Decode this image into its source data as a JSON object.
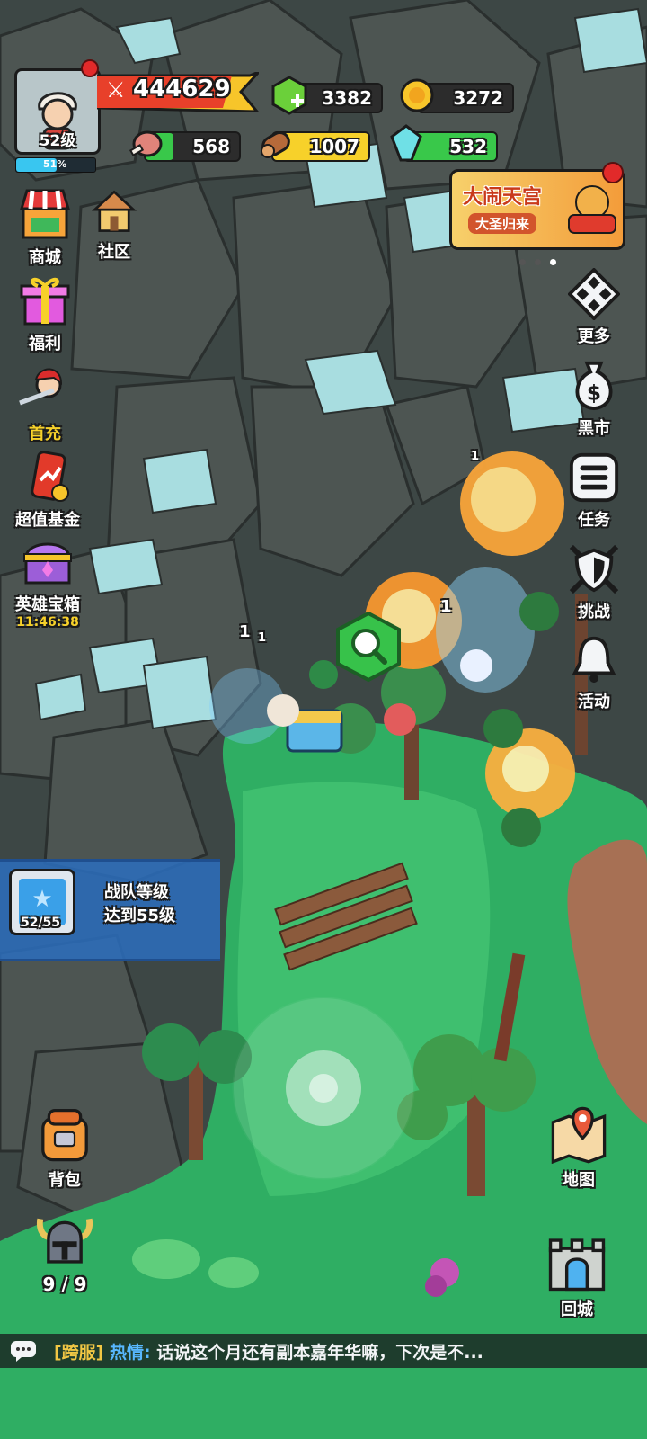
{
  "player": {
    "level_label": "52级",
    "xp_percent_label": "51%",
    "xp_fraction": 0.51,
    "power": "444629",
    "notification": true
  },
  "resources": {
    "gems": "3382",
    "gold": "3272",
    "meat": "568",
    "wood": "1007",
    "crystal": "532"
  },
  "event_banner": {
    "title": "大闹天宫",
    "subtitle": "大圣归来"
  },
  "left_menu": {
    "shop": "商城",
    "community": "社区",
    "welfare": "福利",
    "first_charge": "首充",
    "fund": "超值基金",
    "hero_chest": "英雄宝箱",
    "hero_chest_timer": "11:46:38"
  },
  "right_menu": {
    "more": "更多",
    "black_market": "黑市",
    "tasks": "任务",
    "challenge": "挑战",
    "events": "活动"
  },
  "quest": {
    "progress": "52/55",
    "line1": "战队等级",
    "line2": "达到55级"
  },
  "bottom": {
    "backpack": "背包",
    "map": "地图",
    "return_city": "回城",
    "squad_count": "9 / 9"
  },
  "chat": {
    "channel": "[跨服]",
    "sender": "热情:",
    "message": "话说这个月还有副本嘉年华嘛，下次是不..."
  },
  "damage_numbers": [
    "1",
    "1",
    "1",
    "1"
  ],
  "colors": {
    "power_banner": "#e8402a",
    "gold_banner": "#f7c52a",
    "xp_bar": "#39c6f0",
    "grass": "#2fae63",
    "rock": "#4a4f4d",
    "snow": "#a8dde0",
    "chat_channel": "#f2c744",
    "chat_sender": "#58b8ff"
  }
}
